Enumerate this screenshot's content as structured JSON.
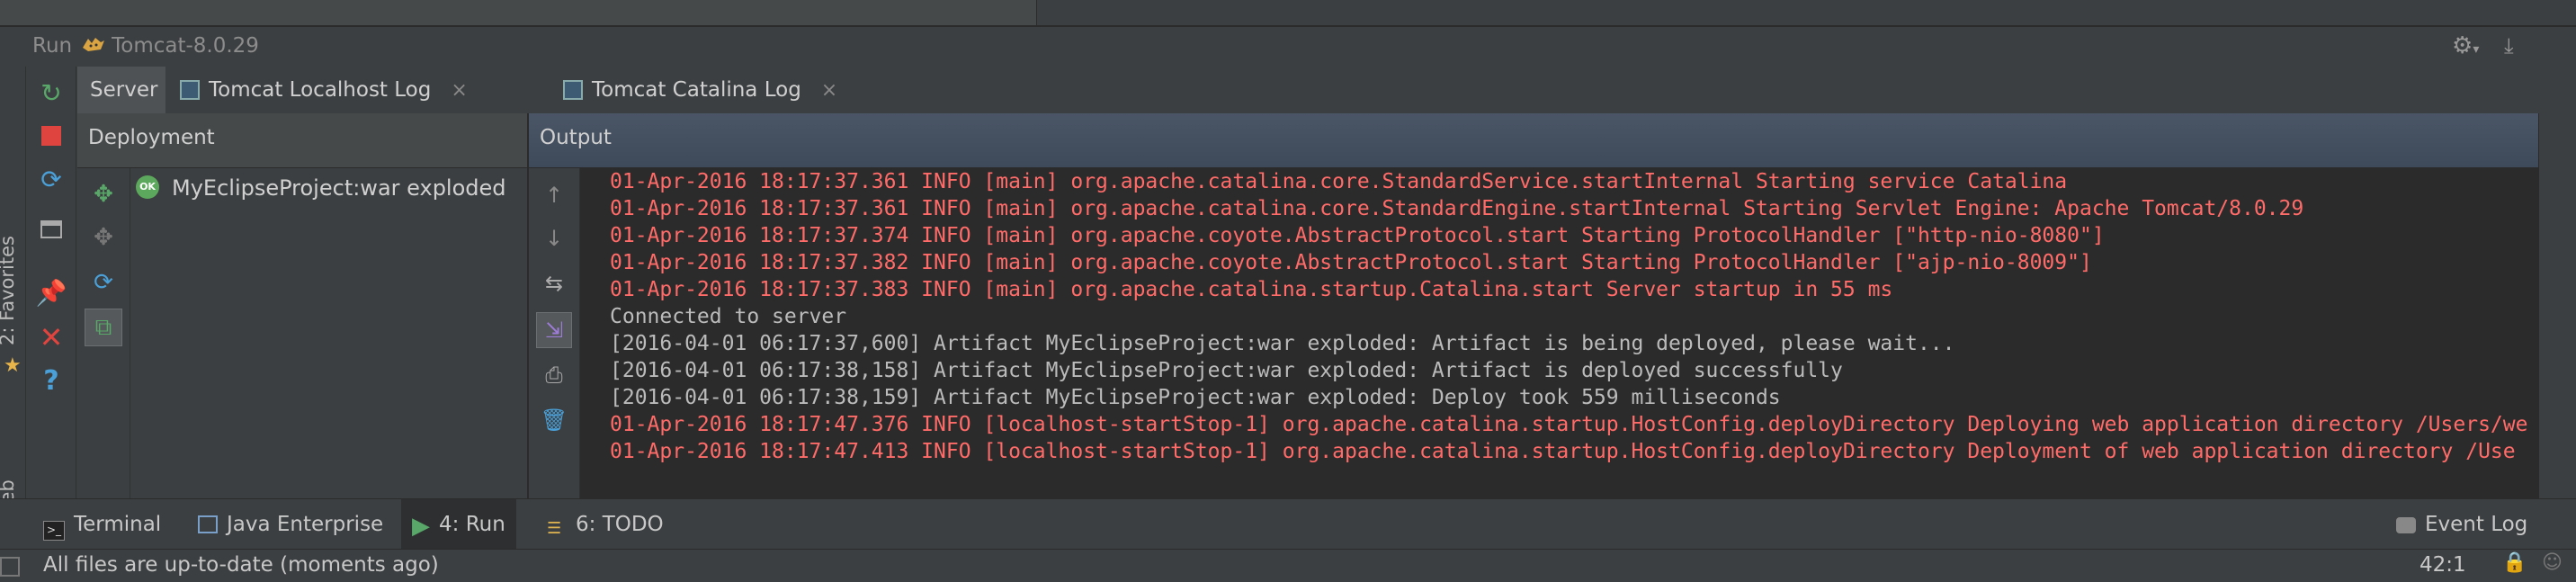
{
  "title": {
    "prefix": "Run",
    "config": "Tomcat-8.0.29"
  },
  "tabs": [
    {
      "label": "Server",
      "active": true
    },
    {
      "label": "Tomcat Localhost Log",
      "active": false
    },
    {
      "label": "Tomcat Catalina Log",
      "active": false
    }
  ],
  "tab_close_glyph": "×",
  "side_labels": {
    "favorites": "2: Favorites",
    "web": "Web"
  },
  "deployment": {
    "header": "Deployment",
    "badge": "OK",
    "item": "MyEclipseProject:war exploded"
  },
  "output": {
    "header": "Output",
    "lines": [
      {
        "text": "01-Apr-2016 18:17:37.361 INFO [main] org.apache.catalina.core.StandardService.startInternal Starting service Catalina",
        "color": "#ff6b68"
      },
      {
        "text": "01-Apr-2016 18:17:37.361 INFO [main] org.apache.catalina.core.StandardEngine.startInternal Starting Servlet Engine: Apache Tomcat/8.0.29",
        "color": "#ff6b68"
      },
      {
        "text": "01-Apr-2016 18:17:37.374 INFO [main] org.apache.coyote.AbstractProtocol.start Starting ProtocolHandler [\"http-nio-8080\"]",
        "color": "#ff6b68"
      },
      {
        "text": "01-Apr-2016 18:17:37.382 INFO [main] org.apache.coyote.AbstractProtocol.start Starting ProtocolHandler [\"ajp-nio-8009\"]",
        "color": "#ff6b68"
      },
      {
        "text": "01-Apr-2016 18:17:37.383 INFO [main] org.apache.catalina.startup.Catalina.start Server startup in 55 ms",
        "color": "#ff6b68"
      },
      {
        "text": "Connected to server",
        "color": "#bbbbbb"
      },
      {
        "text": "[2016-04-01 06:17:37,600] Artifact MyEclipseProject:war exploded: Artifact is being deployed, please wait...",
        "color": "#bbbbbb"
      },
      {
        "text": "[2016-04-01 06:17:38,158] Artifact MyEclipseProject:war exploded: Artifact is deployed successfully",
        "color": "#bbbbbb"
      },
      {
        "text": "[2016-04-01 06:17:38,159] Artifact MyEclipseProject:war exploded: Deploy took 559 milliseconds",
        "color": "#bbbbbb"
      },
      {
        "text": "01-Apr-2016 18:17:47.376 INFO [localhost-startStop-1] org.apache.catalina.startup.HostConfig.deployDirectory Deploying web application directory /Users/we",
        "color": "#ff6b68"
      },
      {
        "text": "01-Apr-2016 18:17:47.413 INFO [localhost-startStop-1] org.apache.catalina.startup.HostConfig.deployDirectory Deployment of web application directory /Use",
        "color": "#ff6b68"
      }
    ]
  },
  "toolwindows": [
    {
      "label": "Terminal",
      "active": false
    },
    {
      "label": "Java Enterprise",
      "active": false
    },
    {
      "label": "4: Run",
      "active": true
    },
    {
      "label": "6: TODO",
      "active": false
    }
  ],
  "event_log": "Event Log",
  "status": {
    "message": "All files are up-to-date (moments ago)",
    "position": "42:1"
  },
  "colors": {
    "error_text": "#ff6b68",
    "normal_text": "#bbbbbb",
    "console_bg": "#2b2b2b"
  }
}
